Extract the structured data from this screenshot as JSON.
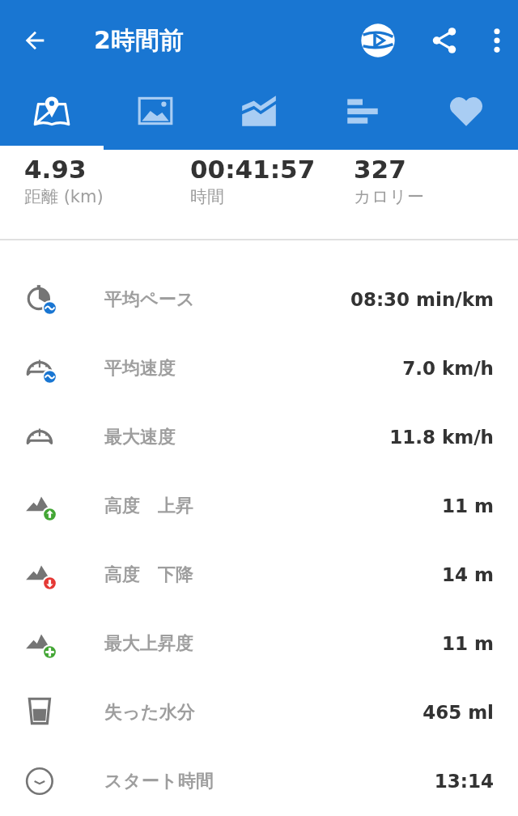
{
  "top_bar": {
    "title": "2時間前"
  },
  "tabs": [
    {
      "kind": "map",
      "selected": true
    },
    {
      "kind": "photo",
      "selected": false
    },
    {
      "kind": "chart",
      "selected": false
    },
    {
      "kind": "splits",
      "selected": false
    },
    {
      "kind": "heart",
      "selected": false
    }
  ],
  "summary": [
    {
      "value": "4.93",
      "label": "距離 (km)"
    },
    {
      "value": "00:41:57",
      "label": "時間"
    },
    {
      "value": "327",
      "label": "カロリー"
    }
  ],
  "stats": [
    {
      "kind": "pace",
      "label": "平均ペース",
      "value": "08:30 min/km"
    },
    {
      "kind": "avg-speed",
      "label": "平均速度",
      "value": "7.0 km/h"
    },
    {
      "kind": "max-speed",
      "label": "最大速度",
      "value": "11.8 km/h"
    },
    {
      "kind": "ascent",
      "label": "高度　上昇",
      "value": "11 m"
    },
    {
      "kind": "descent",
      "label": "高度　下降",
      "value": "14 m"
    },
    {
      "kind": "max-climb",
      "label": "最大上昇度",
      "value": "11 m"
    },
    {
      "kind": "water",
      "label": "失った水分",
      "value": "465 ml"
    },
    {
      "kind": "clock",
      "label": "スタート時間",
      "value": "13:14"
    }
  ]
}
